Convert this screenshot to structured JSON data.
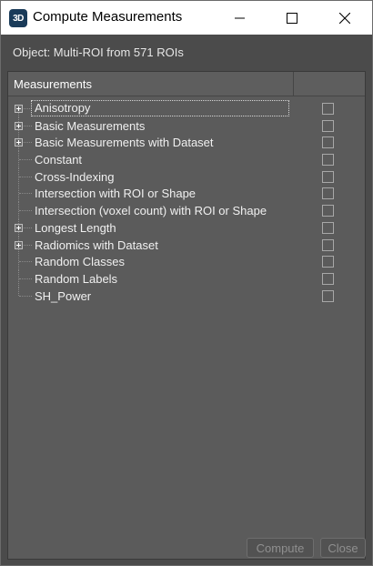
{
  "window": {
    "icon_text": "3D",
    "title": "Compute Measurements"
  },
  "object_line": "Object:  Multi-ROI from 571 ROIs",
  "tree": {
    "header": "Measurements",
    "items": [
      {
        "label": "Anisotropy",
        "expandable": true,
        "focused": true,
        "checked": false
      },
      {
        "label": "Basic Measurements",
        "expandable": true,
        "checked": false
      },
      {
        "label": "Basic Measurements with Dataset",
        "expandable": true,
        "checked": false
      },
      {
        "label": "Constant",
        "expandable": false,
        "checked": false
      },
      {
        "label": "Cross-Indexing",
        "expandable": false,
        "checked": false
      },
      {
        "label": "Intersection with ROI or Shape",
        "expandable": false,
        "checked": false
      },
      {
        "label": "Intersection (voxel count) with ROI or Shape",
        "expandable": false,
        "checked": false
      },
      {
        "label": "Longest Length",
        "expandable": true,
        "checked": false
      },
      {
        "label": "Radiomics with Dataset",
        "expandable": true,
        "checked": false
      },
      {
        "label": "Random Classes",
        "expandable": false,
        "checked": false
      },
      {
        "label": "Random Labels",
        "expandable": false,
        "checked": false
      },
      {
        "label": "SH_Power",
        "expandable": false,
        "checked": false
      }
    ]
  },
  "buttons": {
    "compute": "Compute",
    "close": "Close"
  },
  "colors": {
    "background": "#4b4b4b",
    "tree_background": "#5b5b5b",
    "text": "#f0f0f0",
    "disabled_text": "#8f8f8f"
  }
}
